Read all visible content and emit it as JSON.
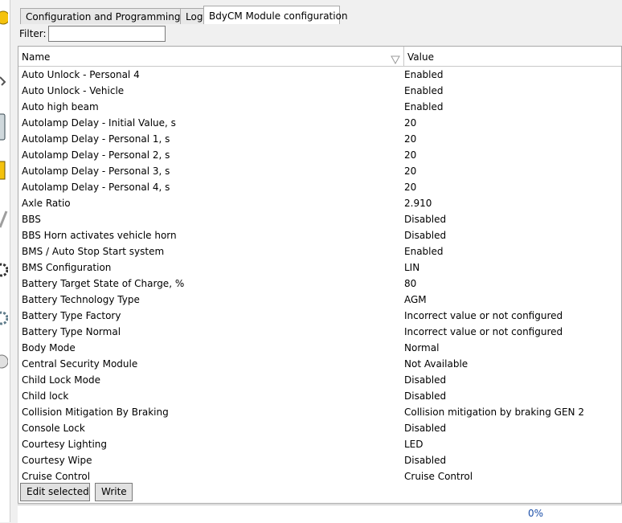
{
  "colors": {
    "accent": "#1a4ea8",
    "grid_border": "#a9a9a9"
  },
  "sidebar": {
    "icons": [
      "bulb-icon",
      "tool-icon",
      "phone-icon",
      "key-icon",
      "wrench-icon",
      "gear-icon",
      "cog-icon",
      "disc-icon"
    ]
  },
  "tabs": [
    {
      "label": "Configuration and Programming"
    },
    {
      "label": "Log"
    },
    {
      "label": "BdyCM Module configuration"
    }
  ],
  "filter": {
    "label": "Filter:",
    "value": ""
  },
  "table": {
    "columns": {
      "name": "Name",
      "value": "Value"
    },
    "sort_icon": "sort-down-icon",
    "rows": [
      {
        "name": "Auto Unlock - Personal 4",
        "value": "Enabled"
      },
      {
        "name": "Auto Unlock - Vehicle",
        "value": "Enabled"
      },
      {
        "name": "Auto high beam",
        "value": "Enabled"
      },
      {
        "name": "Autolamp Delay - Initial Value, s",
        "value": "20"
      },
      {
        "name": "Autolamp Delay - Personal 1, s",
        "value": "20"
      },
      {
        "name": "Autolamp Delay - Personal 2, s",
        "value": "20"
      },
      {
        "name": "Autolamp Delay - Personal 3, s",
        "value": "20"
      },
      {
        "name": "Autolamp Delay - Personal 4, s",
        "value": "20"
      },
      {
        "name": "Axle Ratio",
        "value": "2.910"
      },
      {
        "name": "BBS",
        "value": "Disabled"
      },
      {
        "name": "BBS Horn activates vehicle horn",
        "value": "Disabled"
      },
      {
        "name": "BMS / Auto Stop Start system",
        "value": "Enabled"
      },
      {
        "name": "BMS Configuration",
        "value": "LIN"
      },
      {
        "name": "Battery Target State of Charge, %",
        "value": "80"
      },
      {
        "name": "Battery Technology Type",
        "value": "AGM"
      },
      {
        "name": "Battery Type Factory",
        "value": "Incorrect value or not configured"
      },
      {
        "name": "Battery Type Normal",
        "value": "Incorrect value or not configured"
      },
      {
        "name": "Body Mode",
        "value": "Normal"
      },
      {
        "name": "Central Security Module",
        "value": "Not Available"
      },
      {
        "name": "Child Lock Mode",
        "value": "Disabled"
      },
      {
        "name": "Child lock",
        "value": "Disabled"
      },
      {
        "name": "Collision Mitigation By Braking",
        "value": "Collision mitigation by braking GEN 2"
      },
      {
        "name": "Console Lock",
        "value": "Disabled"
      },
      {
        "name": "Courtesy Lighting",
        "value": "LED"
      },
      {
        "name": "Courtesy Wipe",
        "value": "Disabled"
      },
      {
        "name": "Cruise Control",
        "value": "Cruise Control"
      }
    ]
  },
  "buttons": {
    "edit_selected": "Edit selected",
    "write": "Write"
  },
  "status": {
    "progress": "0%"
  }
}
